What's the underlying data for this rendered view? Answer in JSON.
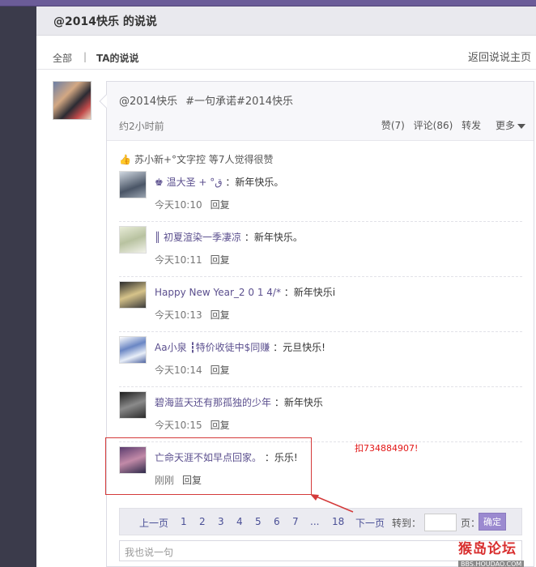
{
  "header": {
    "title": "@2014快乐 的说说"
  },
  "nav": {
    "all": "全部",
    "separator": "|",
    "ta": "TA的说说",
    "back": "返回说说主页"
  },
  "post": {
    "author": "@2014快乐",
    "content": "#一句承诺#2014快乐",
    "time": "约2小时前",
    "like": "赞(7)",
    "comment": "评论(86)",
    "share": "转发",
    "more": "更多"
  },
  "likes": {
    "text": "苏小新+°文字控 等7人觉得很赞"
  },
  "comments": [
    {
      "name": "♚ 温大圣 + °ق",
      "text": "：新年快乐。",
      "time": "今天10:10",
      "reply": "回复"
    },
    {
      "name": "║ 初夏渲染一季凄凉",
      "text": "：新年快乐。",
      "time": "今天10:11",
      "reply": "回复"
    },
    {
      "name": "Happy New Year_2 0 1 4/*",
      "text": "：新年快乐i",
      "time": "今天10:13",
      "reply": "回复"
    },
    {
      "name": "Aa小泉 ┇特价收徒中$同赚",
      "text": "：元旦快乐!",
      "time": "今天10:14",
      "reply": "回复"
    },
    {
      "name": "碧海蓝天还有那孤独的少年",
      "text": "：新年快乐",
      "time": "今天10:15",
      "reply": "回复"
    },
    {
      "name": "亡命天涯不如早点回家。",
      "text": "：乐乐!",
      "time": "刚刚",
      "reply": "回复"
    }
  ],
  "pager": {
    "prev": "上一页",
    "pages": [
      "1",
      "2",
      "3",
      "4",
      "5",
      "6",
      "7"
    ],
    "ellipsis": "...",
    "last": "18",
    "next": "下一页",
    "goto": "转到：",
    "page_unit": "页：",
    "confirm": "确定"
  },
  "reply_box": {
    "placeholder": "我也说一句"
  },
  "annotation": {
    "text": "扣734884907!"
  },
  "watermark": {
    "name": "猴岛论坛",
    "url": "BBS.HOUDAO.COM"
  },
  "colors": {
    "accent": "#5b4f8e",
    "annotation": "#e21616",
    "confirm_button": "#9b8ad0"
  }
}
